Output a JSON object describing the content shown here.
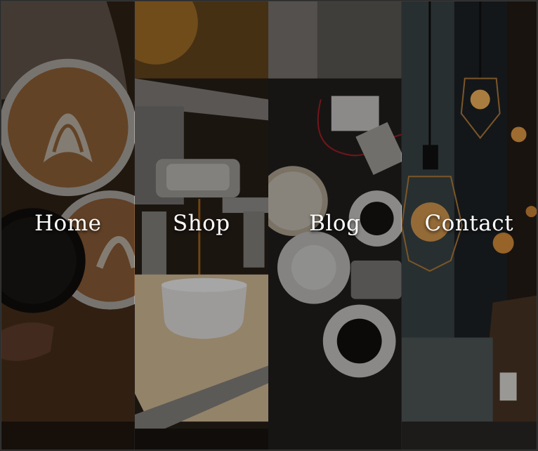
{
  "nav": {
    "items": [
      {
        "label": "Home"
      },
      {
        "label": "Shop"
      },
      {
        "label": "Blog"
      },
      {
        "label": "Contact"
      }
    ]
  },
  "colors": {
    "label_text": "#ffffff",
    "overlay": "#000000",
    "wood": "#6b4a2b",
    "bulb_glow": "#f2b35c"
  }
}
